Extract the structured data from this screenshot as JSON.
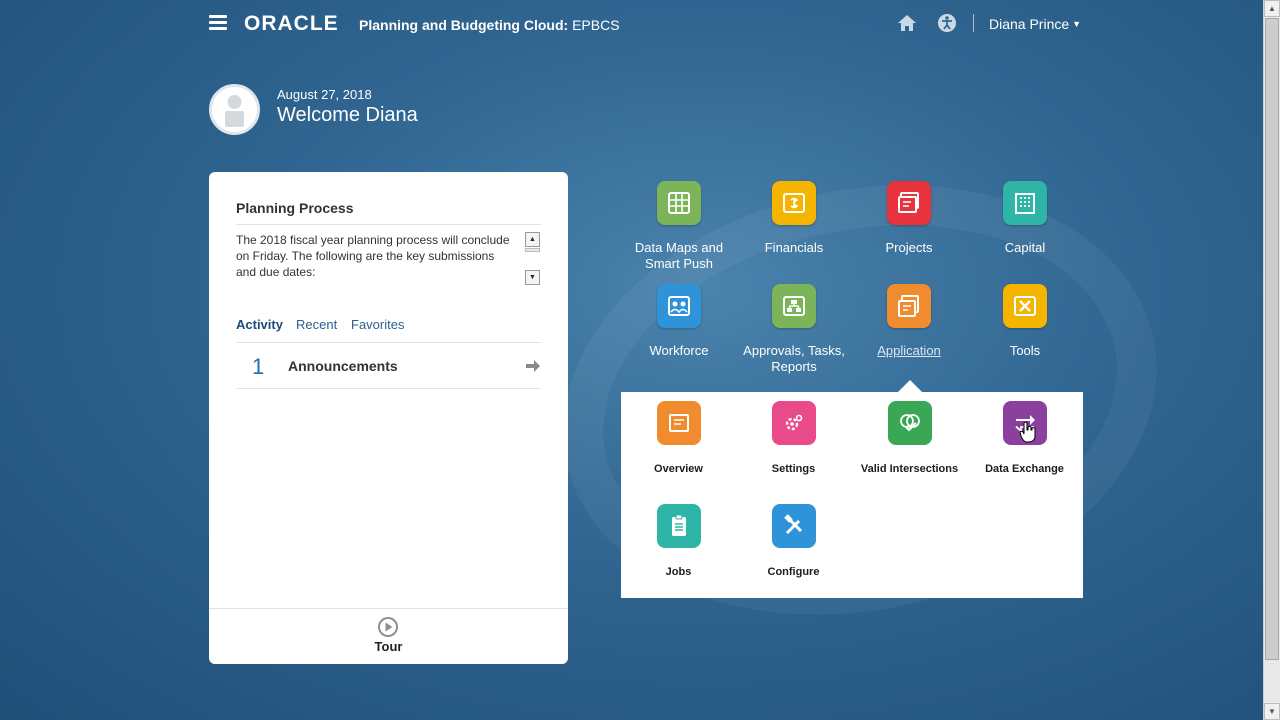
{
  "header": {
    "logo": "ORACLE",
    "app_title_bold": "Planning and Budgeting Cloud:",
    "app_title_rest": " EPBCS",
    "user": "Diana Prince"
  },
  "welcome": {
    "date": "August 27, 2018",
    "title": "Welcome Diana"
  },
  "panel": {
    "title": "Planning Process",
    "text": "The 2018 fiscal year planning process will conclude on Friday.  The following are the key submissions and due dates:",
    "tabs": [
      "Activity",
      "Recent",
      "Favorites"
    ],
    "announcement_count": "1",
    "announcement_label": "Announcements",
    "tour_label": "Tour"
  },
  "tiles": [
    {
      "label": "Data Maps and Smart Push",
      "color": "#7cb45a"
    },
    {
      "label": "Financials",
      "color": "#f4b400"
    },
    {
      "label": "Projects",
      "color": "#e8323c"
    },
    {
      "label": "Capital",
      "color": "#2fb5a8"
    },
    {
      "label": "Workforce",
      "color": "#2f93d9"
    },
    {
      "label": "Approvals, Tasks, Reports",
      "color": "#7cb45a"
    },
    {
      "label": "Application",
      "color": "#f08b2e"
    },
    {
      "label": "Tools",
      "color": "#f4b400"
    }
  ],
  "submenu": [
    {
      "label": "Overview",
      "color": "#f08b2e"
    },
    {
      "label": "Settings",
      "color": "#e84a8a"
    },
    {
      "label": "Valid Intersections",
      "color": "#3aa757"
    },
    {
      "label": "Data Exchange",
      "color": "#8b3f9e"
    },
    {
      "label": "Jobs",
      "color": "#2fb5a8"
    },
    {
      "label": "Configure",
      "color": "#2f93d9"
    }
  ]
}
